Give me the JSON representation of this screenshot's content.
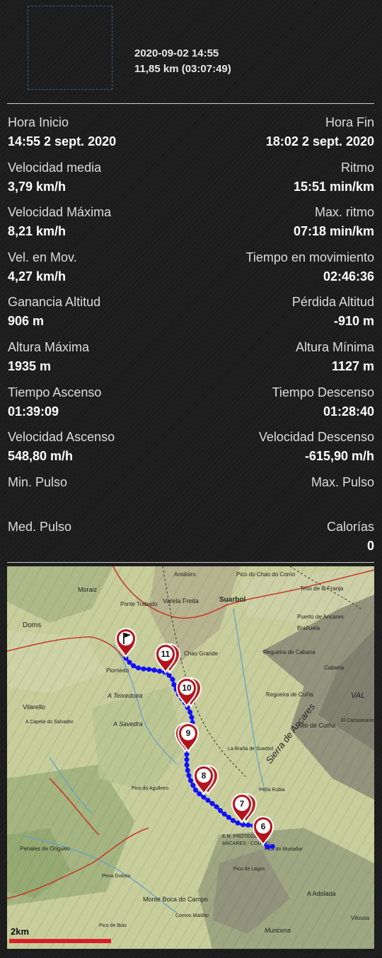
{
  "header": {
    "datetime": "2020-09-02 14:55",
    "summary": "11,85 km (03:07:49)"
  },
  "stats": [
    {
      "left_label": "Hora Inicio",
      "left_value": "14:55 2 sept. 2020",
      "right_label": "Hora Fin",
      "right_value": "18:02 2 sept. 2020"
    },
    {
      "left_label": "Velocidad media",
      "left_value": "3,79 km/h",
      "right_label": "Ritmo",
      "right_value": "15:51 min/km"
    },
    {
      "left_label": "Velocidad Máxima",
      "left_value": "8,21 km/h",
      "right_label": "Max. ritmo",
      "right_value": "07:18 min/km"
    },
    {
      "left_label": "Vel. en Mov.",
      "left_value": "4,27 km/h",
      "right_label": "Tiempo en movimiento",
      "right_value": "02:46:36"
    },
    {
      "left_label": "Ganancia Altitud",
      "left_value": "906 m",
      "right_label": "Pérdida Altitud",
      "right_value": "-910 m"
    },
    {
      "left_label": "Altura Máxima",
      "left_value": "1935 m",
      "right_label": "Altura Mínima",
      "right_value": "1127 m"
    },
    {
      "left_label": "Tiempo Ascenso",
      "left_value": "01:39:09",
      "right_label": "Tiempo Descenso",
      "right_value": "01:28:40"
    },
    {
      "left_label": "Velocidad Ascenso",
      "left_value": "548,80 m/h",
      "right_label": "Velocidad Descenso",
      "right_value": "-615,90 m/h"
    },
    {
      "left_label": "Min. Pulso",
      "left_value": "",
      "right_label": "Max. Pulso",
      "right_value": ""
    },
    {
      "left_label": "Med. Pulso",
      "left_value": "",
      "right_label": "Calorías",
      "right_value": "0"
    }
  ],
  "map": {
    "scale_label": "2km",
    "track_color": "#1010ff",
    "marker_color": "#b3151d",
    "scale_color": "#d81e2a",
    "markers": [
      "6",
      "7",
      "8",
      "9",
      "10",
      "11"
    ],
    "place_labels": {
      "ansiloiro": "Ansiloiro",
      "pico_chao_corno": "Pico do Chao do Corno",
      "teso_franja": "Teso de la Franja",
      "moraiz": "Moraiz",
      "ponte_trabado": "Ponte Trabado",
      "varela_freita": "Varela Freita",
      "suarbol": "Suarbol",
      "puerto_ancares": "Puerto de Ancares",
      "doms": "Doms",
      "brañuela": "Brañuela",
      "chao_grande": "Chao Grande",
      "regueira_cabana": "Regueira de Cabana",
      "cabana": "Cabana",
      "piornedo": "Piornedo",
      "teixedoira": "A Teixedoira",
      "regueira_cuiña": "Regueira de Cuiña",
      "sierra_de_ancares": "Sierra de Ancares",
      "val": "VAL",
      "vilarello": "Vilarello",
      "capela": "A Capela do Salvador",
      "a_savedra": "A Savedra",
      "alto_cuiña": "Alto de Cuiña",
      "el_campanario": "El Campanario",
      "braña_suarbol": "La Braña de Suarbol",
      "pico_agulleiro": "Pico do Agulleiro",
      "peña_rubia": "Peña Rubia",
      "pico_mustallar": "Pico do Mustallar",
      "en_protegido": "E.N. PROTEGIDO",
      "ancares_courel": "ANCARES - COUREL",
      "pico_lagos": "Pico de Lagos",
      "a_adolada": "A Adolada",
      "penales_origueo": "Penales de Origueo",
      "pena_goloso": "Pena Goloso",
      "monte_boca": "Monte Boca do Campo",
      "cornos_maldito": "Cornos Maldito",
      "pico_bois": "Pico de Bois",
      "vilousa": "Vilousa",
      "muricena": "Muricena"
    }
  }
}
